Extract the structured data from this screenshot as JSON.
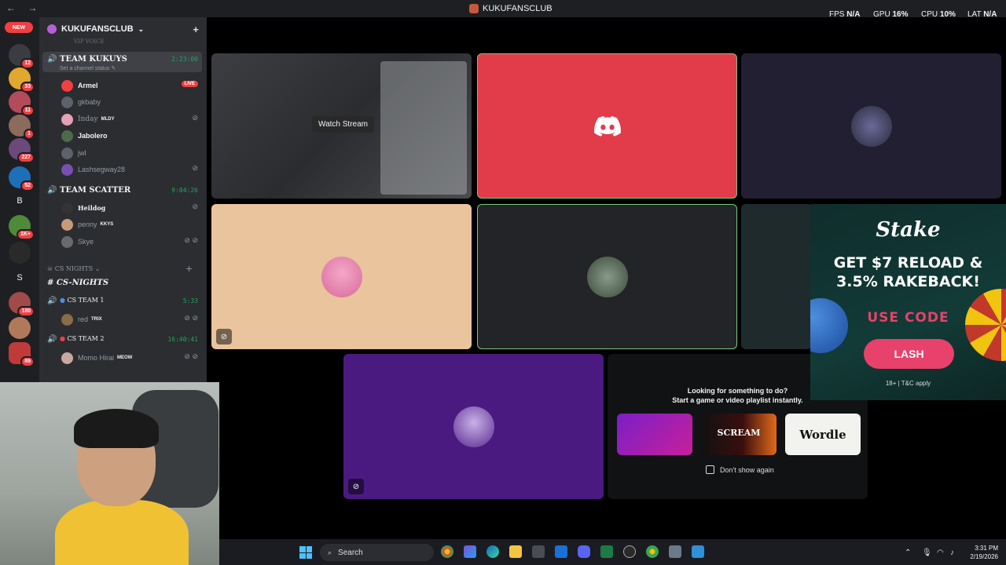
{
  "window": {
    "title": "KUKUFANSCLUB",
    "back": "←",
    "forward": "→"
  },
  "perf": {
    "fps_label": "FPS",
    "fps_value": "N/A",
    "gpu_label": "GPU",
    "gpu_value": "16%",
    "cpu_label": "CPU",
    "cpu_value": "10%",
    "lat_label": "LAT",
    "lat_value": "N/A"
  },
  "server_rail": {
    "new_label": "NEW",
    "servers": [
      {
        "badge": "12"
      },
      {
        "badge": "33"
      },
      {
        "badge": "11"
      },
      {
        "badge": "1"
      },
      {
        "badge": "227"
      },
      {
        "badge": "52"
      },
      {
        "letter": "B"
      },
      {
        "badge": "1K+"
      },
      {
        "badge": ""
      },
      {
        "letter": "S"
      },
      {
        "badge": "180"
      },
      {
        "badge": ""
      },
      {
        "badge": "89"
      }
    ]
  },
  "sidebar": {
    "guild_name": "KUKUFANSCLUB",
    "guild_chevron": "⌄",
    "top_clip": "VIP VOICE",
    "team_kukuys": {
      "name": "TEAM KUKUYS",
      "time": "2:23:00",
      "status": "Set a channel status ✎"
    },
    "members_a": [
      {
        "name": "Armel",
        "bold": true,
        "live": "LIVE"
      },
      {
        "name": "gkbaby"
      },
      {
        "name": "Inday",
        "tag": "MLDY",
        "muted": true
      },
      {
        "name": "Jabolero",
        "bold": true
      },
      {
        "name": "jwl"
      },
      {
        "name": "Lashsegway28",
        "muted": true
      }
    ],
    "team_scatter": {
      "name": "TEAM SCATTER",
      "time": "9:04:26"
    },
    "members_b": [
      {
        "name": "Heildog",
        "muted": true
      },
      {
        "name": "penny",
        "tag": "KKYS"
      },
      {
        "name": "Skye",
        "muted": true
      }
    ],
    "category": "CS NIGHTS",
    "text_channel": "CS-NIGHTS",
    "cs_team_1": {
      "name": "CS TEAM 1",
      "time": "5:33"
    },
    "member_c": {
      "name": "red",
      "tag": "TRIX"
    },
    "cs_team_2": {
      "name": "CS TEAM 2",
      "time": "16:40:41"
    },
    "member_d": {
      "name": "Momo Hirai",
      "tag": "MEOW"
    }
  },
  "stage": {
    "watch_stream": "Watch Stream",
    "activity": {
      "line1": "Looking for something to do?",
      "line2": "Start a game or video playlist instantly.",
      "games": [
        "",
        "SCREAM",
        "Wordle"
      ],
      "dont_show": "Don't show again"
    }
  },
  "ad": {
    "brand": "Stake",
    "headline1": "GET $7 RELOAD &",
    "headline2": "3.5% RAKEBACK!",
    "use_code": "USE CODE",
    "code": "LASH",
    "fine_print": "18+ | T&C apply"
  },
  "taskbar": {
    "search_placeholder": "Search",
    "time": "3:31 PM",
    "date": "2/19/2026"
  },
  "icons": {
    "speaker": "🔊",
    "mute": "🎙",
    "hash": "#",
    "search": "🔍",
    "add_member": "👤"
  },
  "colors": {
    "accent_green": "#23a55a",
    "live_red": "#f23f42",
    "discord_tile": "#e23b4a",
    "stake_pink": "#e8416b"
  }
}
